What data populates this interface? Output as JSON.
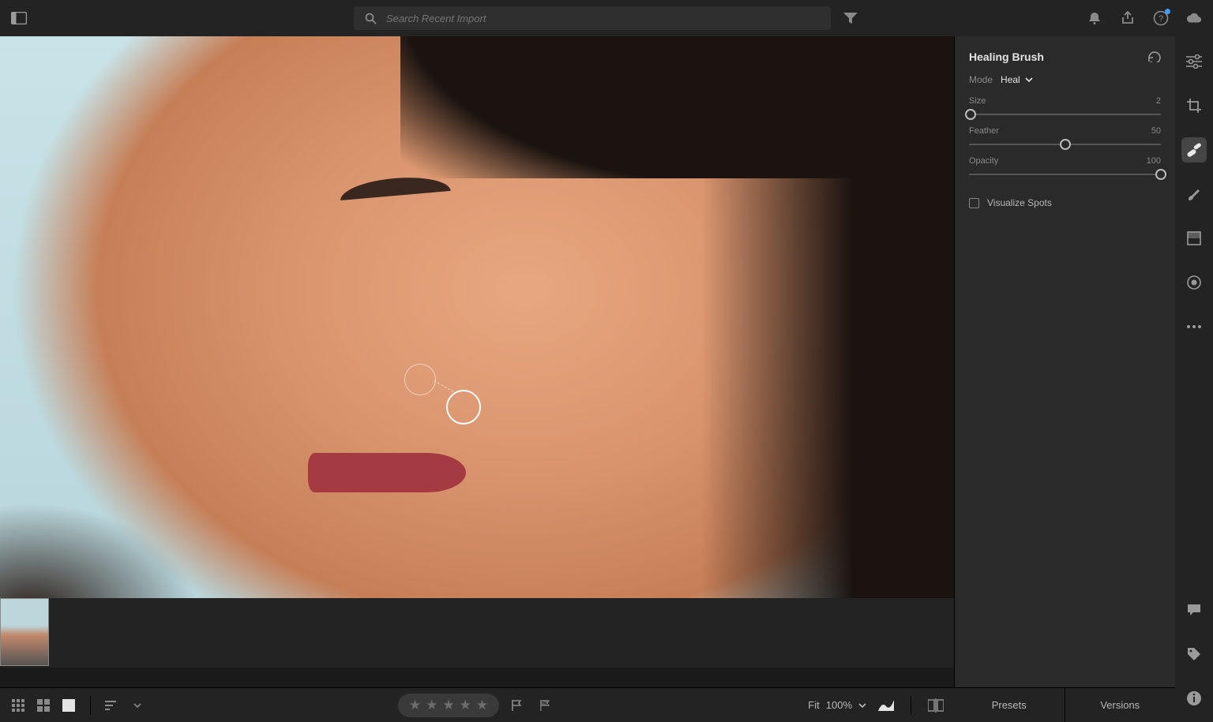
{
  "topbar": {
    "search_placeholder": "Search Recent Import"
  },
  "panel": {
    "title": "Healing Brush",
    "mode_label": "Mode",
    "mode_value": "Heal",
    "sliders": {
      "size": {
        "label": "Size",
        "value": 2,
        "pct": 1
      },
      "feather": {
        "label": "Feather",
        "value": 50,
        "pct": 50
      },
      "opacity": {
        "label": "Opacity",
        "value": 100,
        "pct": 100
      }
    },
    "visualize_label": "Visualize Spots",
    "visualize_checked": false
  },
  "bottombar": {
    "zoom_fit": "Fit",
    "zoom_pct": "100%"
  },
  "tabs": {
    "presets": "Presets",
    "versions": "Versions"
  }
}
